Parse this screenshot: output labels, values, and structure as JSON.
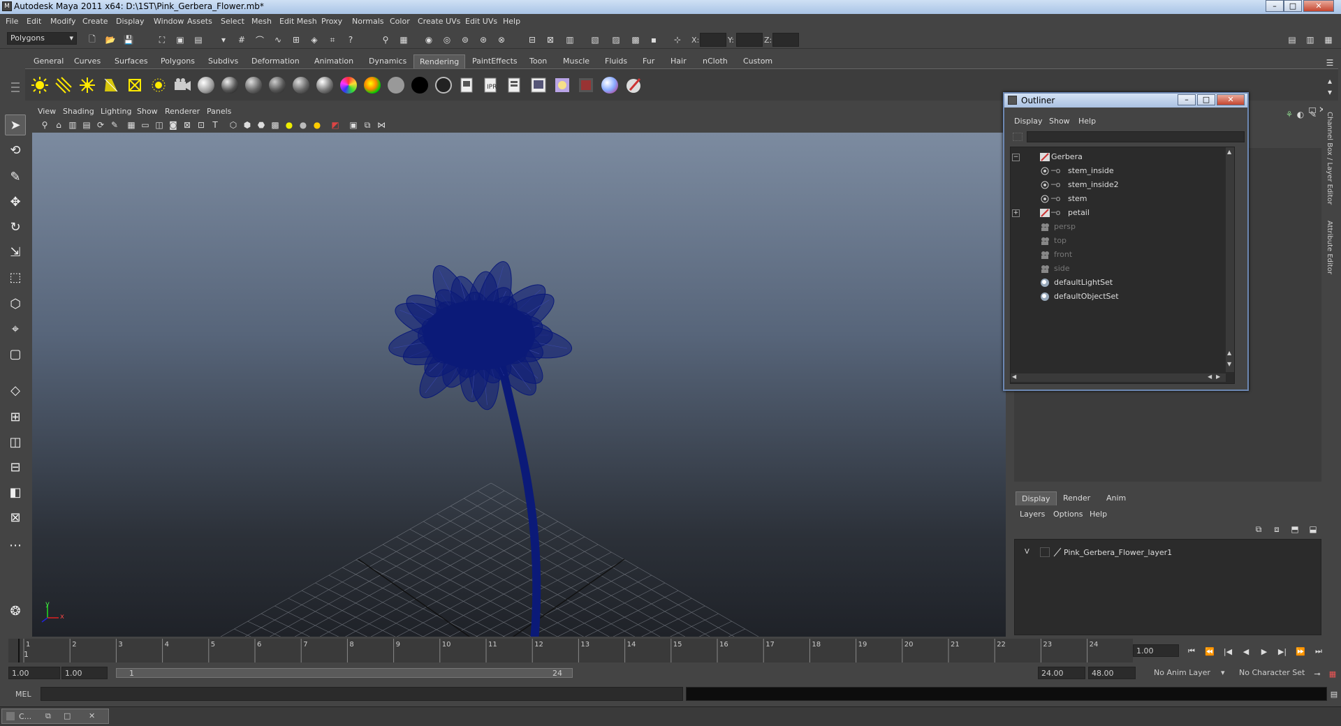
{
  "window": {
    "title": "Autodesk Maya 2011 x64: D:\\1ST\\Pink_Gerbera_Flower.mb*",
    "minimize": "–",
    "maximize": "□",
    "close": "✕"
  },
  "menubar": [
    "File",
    "Edit",
    "Modify",
    "Create",
    "Display",
    "Window",
    "Assets",
    "Select",
    "Mesh",
    "Edit Mesh",
    "Proxy",
    "Normals",
    "Color",
    "Create UVs",
    "Edit UVs",
    "Help"
  ],
  "statusline": {
    "mode": "Polygons",
    "x_label": "X:",
    "y_label": "Y:",
    "z_label": "Z:"
  },
  "shelf_tabs": [
    "General",
    "Curves",
    "Surfaces",
    "Polygons",
    "Subdivs",
    "Deformation",
    "Animation",
    "Dynamics",
    "Rendering",
    "PaintEffects",
    "Toon",
    "Muscle",
    "Fluids",
    "Fur",
    "Hair",
    "nCloth",
    "Custom"
  ],
  "active_shelf_tab": "Rendering",
  "viewport": {
    "menu": [
      "View",
      "Shading",
      "Lighting",
      "Show",
      "Renderer",
      "Panels"
    ],
    "axis_y": "y",
    "axis_x": "x"
  },
  "outliner": {
    "title": "Outliner",
    "menu": [
      "Display",
      "Show",
      "Help"
    ],
    "items": [
      {
        "label": "Gerbera",
        "expand": "−"
      },
      {
        "label": "stem_inside"
      },
      {
        "label": "stem_inside2"
      },
      {
        "label": "stem"
      },
      {
        "label": "petail",
        "expand": "+"
      },
      {
        "label": "persp"
      },
      {
        "label": "top"
      },
      {
        "label": "front"
      },
      {
        "label": "side"
      },
      {
        "label": "defaultLightSet"
      },
      {
        "label": "defaultObjectSet"
      }
    ]
  },
  "layer_editor": {
    "tabs": [
      "Display",
      "Render",
      "Anim"
    ],
    "menu": [
      "Layers",
      "Options",
      "Help"
    ],
    "layer_visible": "V",
    "layer_name": "Pink_Gerbera_Flower_layer1"
  },
  "side_tabs": [
    "Channel Box / Layer Editor",
    "Attribute Editor"
  ],
  "time_slider": {
    "ticks": [
      "1",
      "2",
      "3",
      "4",
      "5",
      "6",
      "7",
      "8",
      "9",
      "10",
      "11",
      "12",
      "13",
      "14",
      "15",
      "16",
      "17",
      "18",
      "19",
      "20",
      "21",
      "22",
      "23",
      "24"
    ],
    "current_frame_marker": "1",
    "current_time": "1.00"
  },
  "range_slider": {
    "start_time": "1.00",
    "playback_start": "1.00",
    "range_start": "1",
    "range_end": "24",
    "playback_end": "24.00",
    "end_time": "48.00",
    "anim_layer": "No Anim Layer",
    "character_set": "No Character Set"
  },
  "cmdline": {
    "label": "MEL"
  },
  "taskbar": {
    "item": "C..."
  },
  "colors": {
    "flower": "#0b1a78",
    "accent": "#5c84c4"
  }
}
